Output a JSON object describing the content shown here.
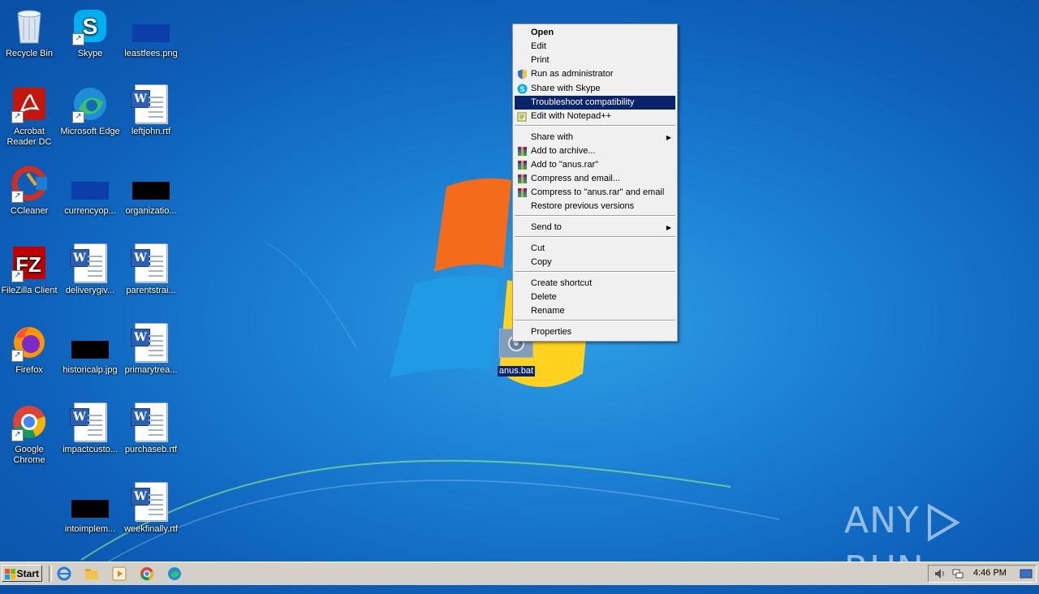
{
  "desktop": {
    "icons": [
      {
        "label": "Recycle Bin",
        "icon": "recycle-bin-icon"
      },
      {
        "label": "Skype",
        "icon": "skype-icon"
      },
      {
        "label": "leastfees.png",
        "icon": "image-file-icon"
      },
      {
        "label": "Acrobat Reader DC",
        "icon": "acrobat-icon"
      },
      {
        "label": "Microsoft Edge",
        "icon": "edge-icon"
      },
      {
        "label": "leftjohn.rtf",
        "icon": "word-document-icon"
      },
      {
        "label": "CCleaner",
        "icon": "ccleaner-icon"
      },
      {
        "label": "currencyop...",
        "icon": "image-file-icon"
      },
      {
        "label": "organizatio...",
        "icon": "image-file-icon"
      },
      {
        "label": "FileZilla Client",
        "icon": "filezilla-icon"
      },
      {
        "label": "deliverygiv...",
        "icon": "word-document-icon"
      },
      {
        "label": "parentstrai...",
        "icon": "word-document-icon"
      },
      {
        "label": "Firefox",
        "icon": "firefox-icon"
      },
      {
        "label": "historicalp.jpg",
        "icon": "image-file-icon"
      },
      {
        "label": "primarytrea...",
        "icon": "word-document-icon"
      },
      {
        "label": "Google Chrome",
        "icon": "chrome-icon"
      },
      {
        "label": "impactcusto...",
        "icon": "word-document-icon"
      },
      {
        "label": "purchaseb.rtf",
        "icon": "word-document-icon"
      },
      {
        "label": "intoimplem...",
        "icon": "image-file-icon"
      },
      {
        "label": "weekfinally.rtf",
        "icon": "word-document-icon"
      }
    ],
    "selected_file": {
      "label": "anus.bat",
      "icon": "batch-file-icon"
    }
  },
  "context_menu": {
    "items": [
      {
        "label": "Open",
        "bold": true
      },
      {
        "label": "Edit"
      },
      {
        "label": "Print"
      },
      {
        "label": "Run as administrator",
        "icon": "uac-shield-icon"
      },
      {
        "label": "Share with Skype",
        "icon": "skype-icon"
      },
      {
        "label": "Troubleshoot compatibility",
        "highlighted": true
      },
      {
        "label": "Edit with Notepad++",
        "icon": "notepadpp-icon"
      },
      {
        "label": "Share with",
        "submenu": true
      },
      {
        "label": "Add to archive...",
        "icon": "winrar-icon"
      },
      {
        "label": "Add to \"anus.rar\"",
        "icon": "winrar-icon"
      },
      {
        "label": "Compress and email...",
        "icon": "winrar-icon"
      },
      {
        "label": "Compress to \"anus.rar\" and email",
        "icon": "winrar-icon"
      },
      {
        "label": "Restore previous versions"
      },
      {
        "label": "Send to",
        "submenu": true
      },
      {
        "label": "Cut"
      },
      {
        "label": "Copy"
      },
      {
        "label": "Create shortcut"
      },
      {
        "label": "Delete"
      },
      {
        "label": "Rename"
      },
      {
        "label": "Properties"
      }
    ]
  },
  "taskbar": {
    "start_label": "Start",
    "pinned": [
      "internet-explorer-icon",
      "file-explorer-icon",
      "media-player-icon",
      "chrome-icon",
      "edge-icon"
    ],
    "tray": {
      "clock": "4:46 PM",
      "icons": [
        "volume-icon",
        "network-icon",
        "show-desktop-icon"
      ]
    }
  },
  "watermark": {
    "left": "ANY",
    "right": "RUN"
  },
  "colors": {
    "highlight": "#0a246a",
    "taskbar": "#d4d0c8",
    "menu_bg": "#f0f0f0"
  }
}
